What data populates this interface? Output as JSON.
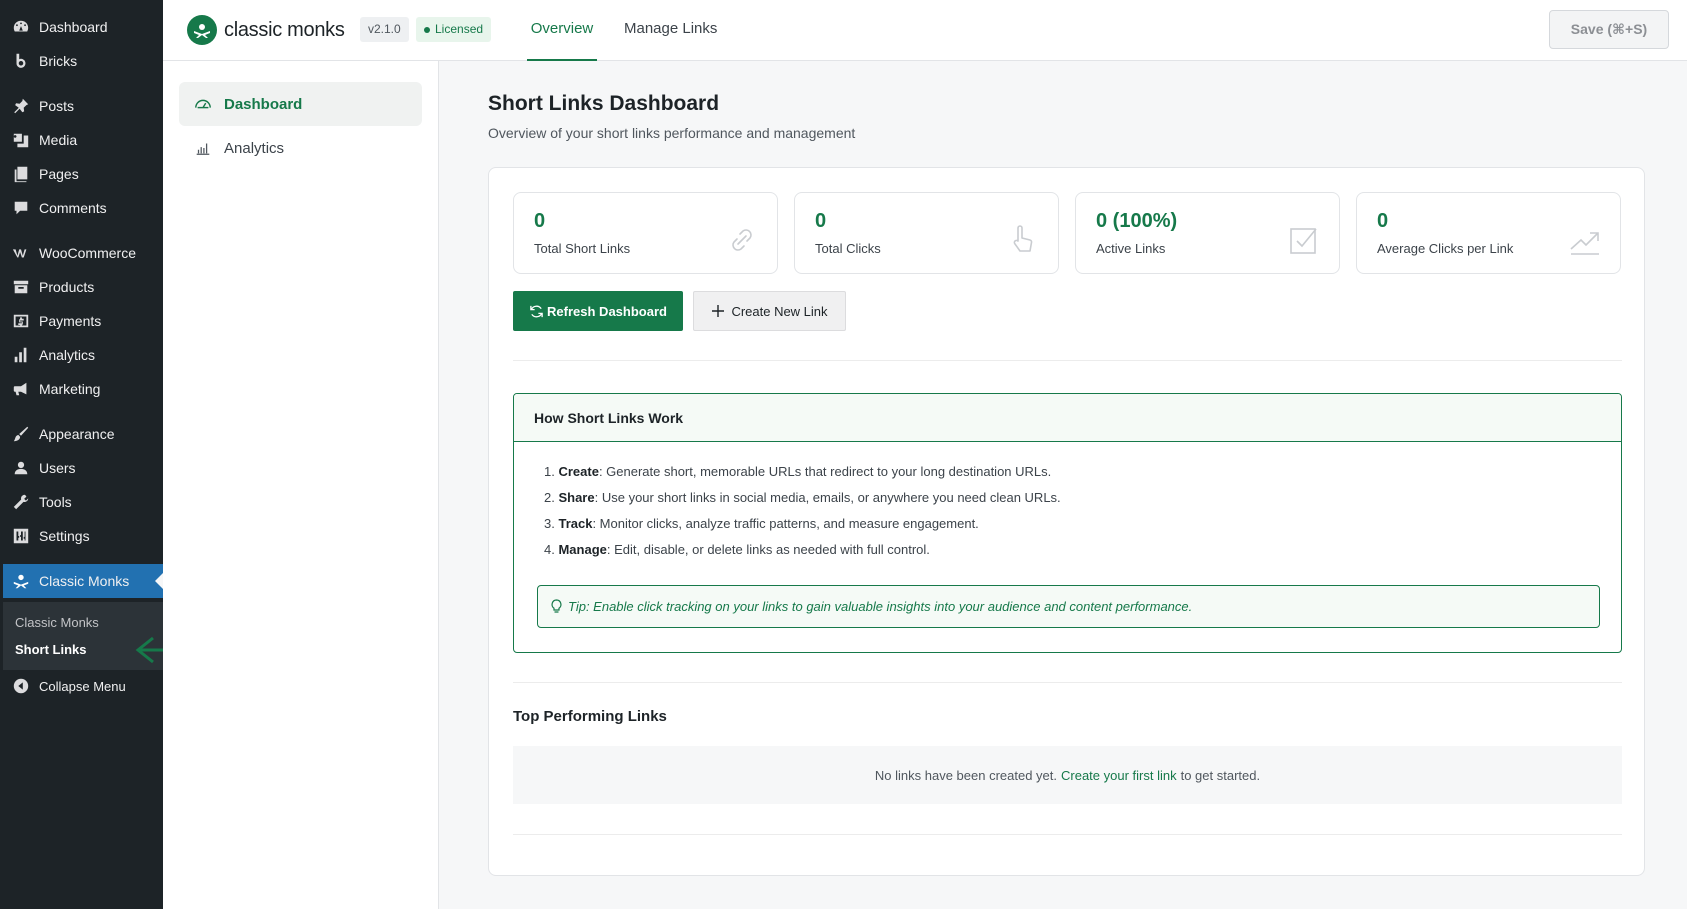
{
  "wp_menu": {
    "items": [
      {
        "label": "Dashboard",
        "icon": "gauge-icon"
      },
      {
        "label": "Bricks",
        "icon": "bricks-icon"
      },
      {
        "label": "Posts",
        "icon": "pushpin-icon"
      },
      {
        "label": "Media",
        "icon": "media-icon"
      },
      {
        "label": "Pages",
        "icon": "pages-icon"
      },
      {
        "label": "Comments",
        "icon": "comment-icon"
      },
      {
        "label": "WooCommerce",
        "icon": "woocommerce-icon"
      },
      {
        "label": "Products",
        "icon": "archive-icon"
      },
      {
        "label": "Payments",
        "icon": "dollar-icon"
      },
      {
        "label": "Analytics",
        "icon": "bar-chart-icon"
      },
      {
        "label": "Marketing",
        "icon": "megaphone-icon"
      },
      {
        "label": "Appearance",
        "icon": "brush-icon"
      },
      {
        "label": "Users",
        "icon": "user-icon"
      },
      {
        "label": "Tools",
        "icon": "wrench-icon"
      },
      {
        "label": "Settings",
        "icon": "sliders-icon"
      },
      {
        "label": "Classic Monks",
        "icon": "classic-monks-icon"
      }
    ],
    "submenu": [
      "Classic Monks",
      "Short Links"
    ],
    "collapse_label": "Collapse Menu"
  },
  "header": {
    "brand": "classic monks",
    "version": "v2.1.0",
    "license": "Licensed",
    "tabs": [
      "Overview",
      "Manage Links"
    ],
    "save_label": "Save (⌘+S)"
  },
  "side_nav": {
    "items": [
      {
        "label": "Dashboard",
        "icon": "dashboard-icon"
      },
      {
        "label": "Analytics",
        "icon": "analytics-icon"
      }
    ]
  },
  "main": {
    "title": "Short Links Dashboard",
    "subtitle": "Overview of your short links performance and management",
    "stats": [
      {
        "value": "0",
        "label": "Total Short Links",
        "icon": "link-icon"
      },
      {
        "value": "0",
        "label": "Total Clicks",
        "icon": "pointer-hand-icon"
      },
      {
        "value": "0 (100%)",
        "label": "Active Links",
        "icon": "checkbox-icon"
      },
      {
        "value": "0",
        "label": "Average Clicks per Link",
        "icon": "trending-up-icon"
      }
    ],
    "refresh_label": "Refresh Dashboard",
    "create_label": "Create New Link",
    "howto": {
      "title": "How Short Links Work",
      "steps": [
        {
          "num": "1.",
          "term": "Create",
          "text": ": Generate short, memorable URLs that redirect to your long destination URLs."
        },
        {
          "num": "2.",
          "term": "Share",
          "text": ": Use your short links in social media, emails, or anywhere you need clean URLs."
        },
        {
          "num": "3.",
          "term": "Track",
          "text": ": Monitor clicks, analyze traffic patterns, and measure engagement."
        },
        {
          "num": "4.",
          "term": "Manage",
          "text": ": Edit, disable, or delete links as needed with full control."
        }
      ],
      "tip": "Tip: Enable click tracking on your links to gain valuable insights into your audience and content performance."
    },
    "top_links": {
      "title": "Top Performing Links",
      "empty_before": "No links have been created yet.",
      "empty_link": "Create your first link",
      "empty_after": "to get started."
    }
  },
  "colors": {
    "brand_green": "#16794a",
    "wp_sidebar": "#1d2327",
    "wp_active": "#2271b1"
  }
}
